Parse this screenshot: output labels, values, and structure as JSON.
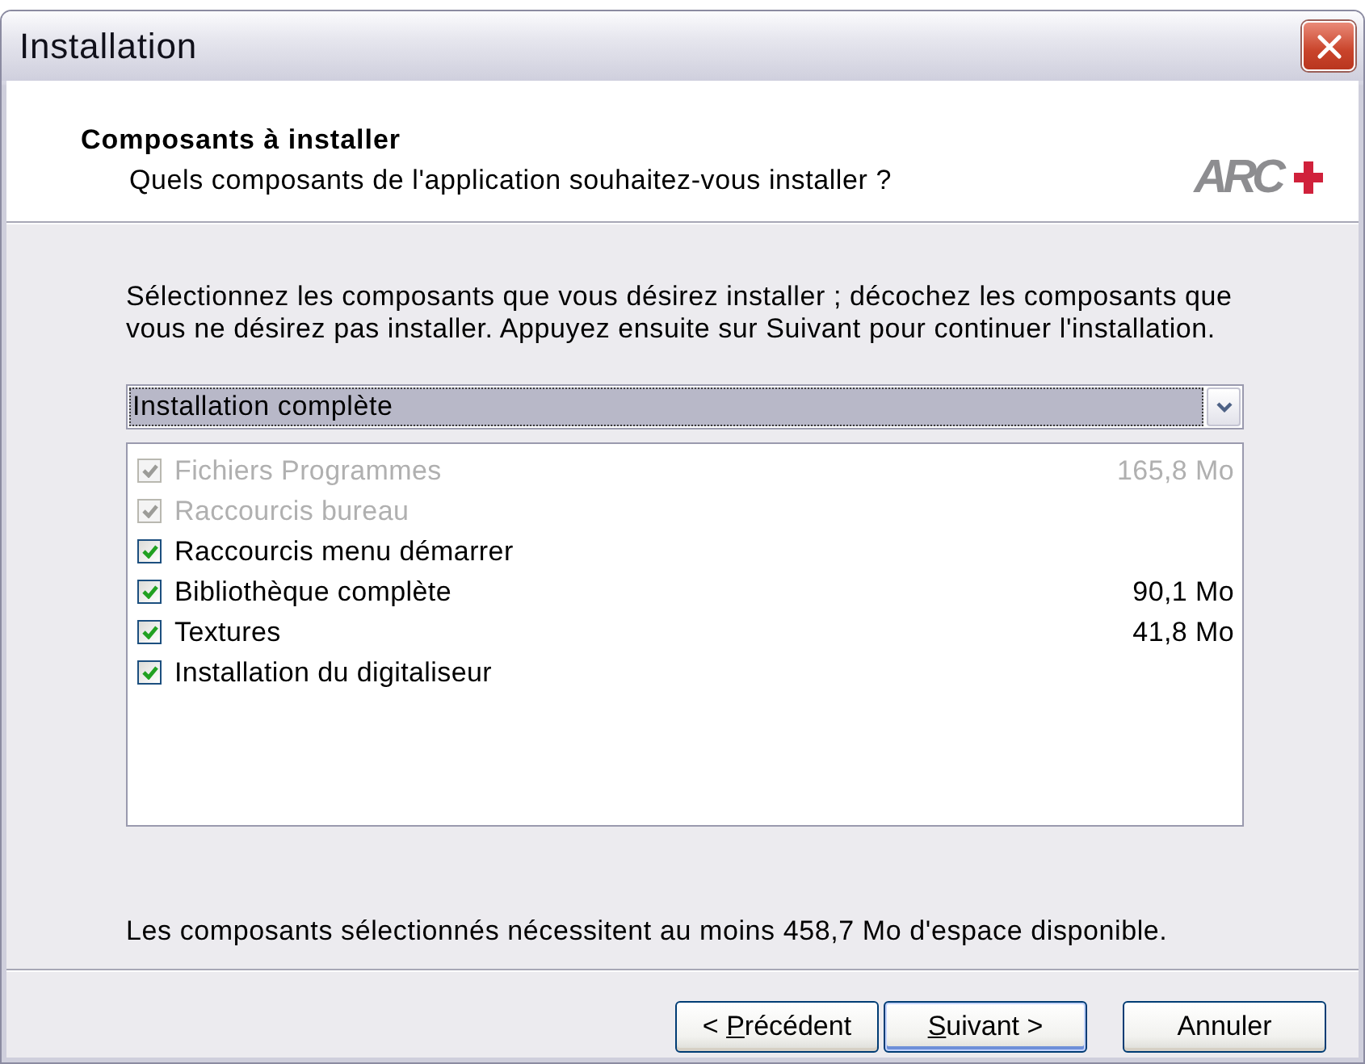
{
  "window": {
    "title": "Installation"
  },
  "header": {
    "title": "Composants à installer",
    "subtitle": "Quels composants de l'application souhaitez-vous installer ?",
    "logo": {
      "text": "ARC"
    }
  },
  "description": [
    "Sélectionnez les composants que vous désirez installer ; décochez les composants que",
    "vous ne désirez pas installer. Appuyez ensuite sur Suivant pour continuer l'installation."
  ],
  "install_type": {
    "value": "Installation complète",
    "focused": true
  },
  "components": [
    {
      "name": "Fichiers Programmes",
      "size": "165,8 Mo",
      "checked": true,
      "disabled": true
    },
    {
      "name": "Raccourcis bureau",
      "checked": true,
      "disabled": true
    },
    {
      "name": "Raccourcis menu démarrer",
      "checked": true,
      "disabled": false
    },
    {
      "name": "Bibliothèque complète",
      "size": "90,1 Mo",
      "checked": true,
      "disabled": false
    },
    {
      "name": "Textures",
      "size": "41,8 Mo",
      "checked": true,
      "disabled": false
    },
    {
      "name": "Installation du digitaliseur",
      "checked": true,
      "disabled": false
    }
  ],
  "space_note": "Les composants sélectionnés nécessitent au moins 458,7 Mo d'espace disponible.",
  "buttons": [
    {
      "kind": "back",
      "text_before": "< ",
      "mnemonic": "P",
      "text_after": "récédent",
      "default": false
    },
    {
      "kind": "next",
      "mnemonic": "S",
      "text_after": "uivant >",
      "default": true
    },
    {
      "kind": "cancel",
      "text_after": "Annuler",
      "default": false
    }
  ]
}
